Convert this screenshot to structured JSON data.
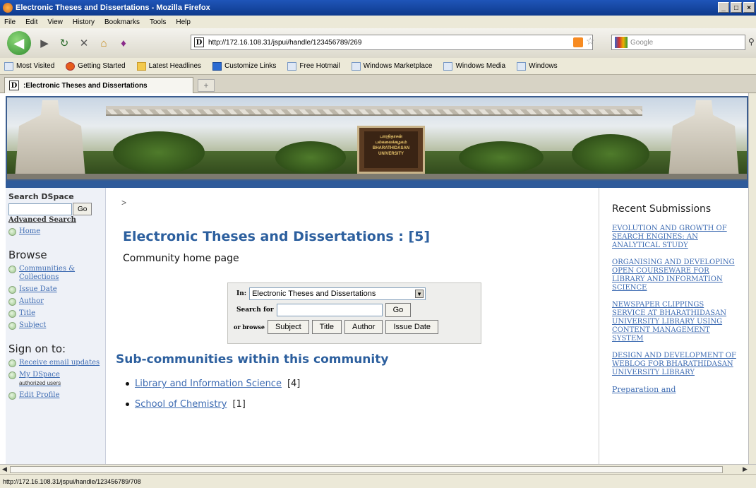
{
  "window": {
    "title": "Electronic Theses and Dissertations - Mozilla Firefox",
    "controls": [
      "_",
      "□",
      "×"
    ]
  },
  "menu": [
    "File",
    "Edit",
    "View",
    "History",
    "Bookmarks",
    "Tools",
    "Help"
  ],
  "nav": {
    "url": "http://172.16.108.31/jspui/handle/123456789/269",
    "search_placeholder": "Google"
  },
  "bookmarks": [
    "Most Visited",
    "Getting Started",
    "Latest Headlines",
    "Customize Links",
    "Free Hotmail",
    "Windows Marketplace",
    "Windows Media",
    "Windows"
  ],
  "tab": {
    "label": ":Electronic Theses and Dissertations",
    "new": "+"
  },
  "banner": {
    "plaque": "பாரதிதாசன் பல்கலைக்கழகம் BHARATHIDASAN UNIVERSITY"
  },
  "left": {
    "search_title": "Search DSpace",
    "go": "Go",
    "advanced": "Advanced Search",
    "home": "Home",
    "browse_title": "Browse",
    "browse": [
      "Communities & Collections",
      "Issue Date",
      "Author",
      "Title",
      "Subject"
    ],
    "signon_title": "Sign on to:",
    "receive": "Receive email updates",
    "mydspace": "My DSpace",
    "mydspace_sub": "authorized users",
    "edit_profile": "Edit Profile"
  },
  "main": {
    "breadcrumb": ">",
    "title": "Electronic Theses and Dissertations : [5]",
    "subtitle": "Community home page",
    "search": {
      "in_label": "In:",
      "scope": "Electronic Theses and Dissertations",
      "search_for": "Search for",
      "go": "Go",
      "or_browse": "or browse",
      "browse_buttons": [
        "Subject",
        "Title",
        "Author",
        "Issue Date"
      ]
    },
    "sub_heading": "Sub-communities within this community",
    "communities": [
      {
        "name": "Library and Information Science",
        "count": "[4]"
      },
      {
        "name": "School of Chemistry",
        "count": "[1]"
      }
    ]
  },
  "right": {
    "title": "Recent Submissions",
    "items": [
      "EVOLUTION AND GROWTH OF SEARCH ENGINES: AN ANALYTICAL STUDY",
      "ORGANISING AND DEVELOPING OPEN COURSEWARE FOR LIBRARY AND INFORMATION SCIENCE",
      "NEWSPAPER CLIPPINGS SERVICE AT BHARATHIDASAN UNIVERSITY LIBRARY USING CONTENT MANAGEMENT SYSTEM",
      "DESIGN AND DEVELOPMENT OF WEBLOG FOR BHARATHIDASAN UNIVERSITY LIBRARY",
      "Preparation and"
    ]
  },
  "status": "http://172.16.108.31/jspui/handle/123456789/708"
}
